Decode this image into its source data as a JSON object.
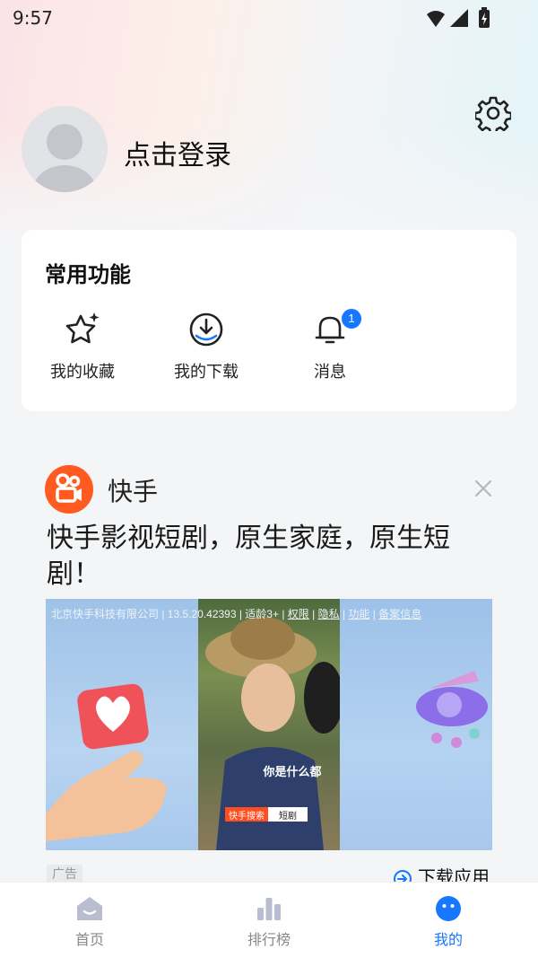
{
  "status_bar": {
    "time": "9:57"
  },
  "profile": {
    "login_text": "点击登录"
  },
  "common_functions": {
    "title": "常用功能",
    "items": [
      {
        "label": "我的收藏",
        "icon": "star-sparkle-icon"
      },
      {
        "label": "我的下载",
        "icon": "download-icon"
      },
      {
        "label": "消息",
        "icon": "bell-icon",
        "badge": "1"
      }
    ]
  },
  "ad": {
    "brand": "快手",
    "headline": "快手影视短剧，原生家庭，原生短剧！",
    "meta_prefix": "北京快手科技有限公司 | 13.5.20.42393 | 适龄3+ | ",
    "meta_links": [
      "权限",
      "隐私",
      "功能",
      "备案信息"
    ],
    "video_subtitle": "你是什么都",
    "search_chip_brand": "快手搜索",
    "search_chip_query": "短剧",
    "ad_label": "广告",
    "download_label": "下载应用"
  },
  "tabbar": {
    "tabs": [
      {
        "label": "首页",
        "icon": "home-icon"
      },
      {
        "label": "排行榜",
        "icon": "ranking-chart-icon"
      },
      {
        "label": "我的",
        "icon": "profile-face-icon",
        "active": true
      }
    ]
  },
  "colors": {
    "accent": "#1677ff",
    "brand_orange": "#ff5a1f"
  }
}
